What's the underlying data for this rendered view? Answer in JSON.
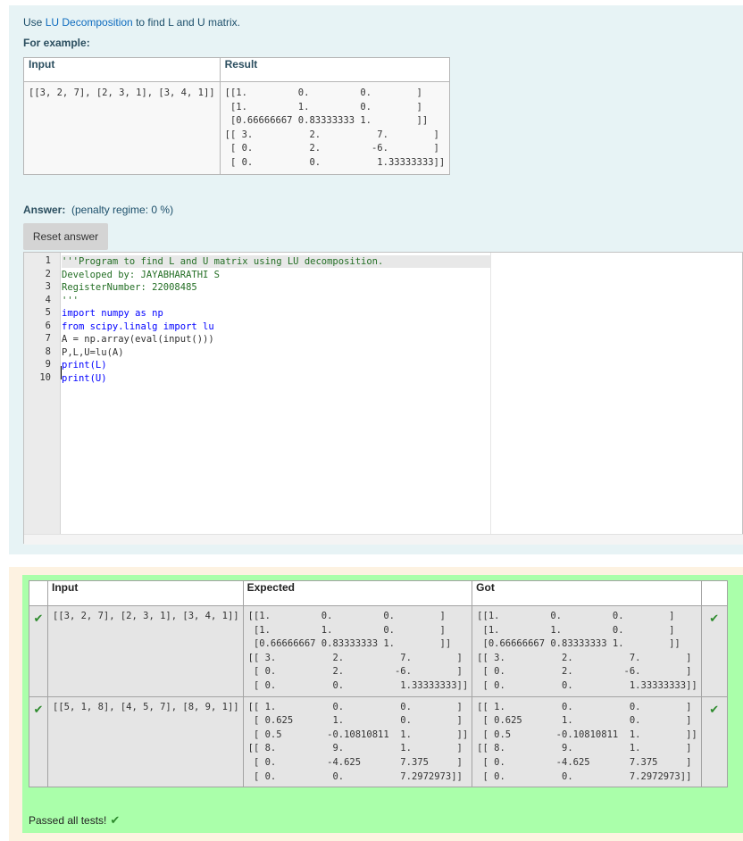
{
  "question": {
    "intro_prefix": "Use ",
    "intro_link": "LU Decomposition",
    "intro_suffix": " to find L and U matrix.",
    "for_example": "For example:",
    "example": {
      "headers": [
        "Input",
        "Result"
      ],
      "input": "[[3, 2, 7], [2, 3, 1], [3, 4, 1]]",
      "result": "[[1.         0.         0.        ]\n [1.         1.         0.        ]\n [0.66666667 0.83333333 1.        ]]\n[[ 3.          2.          7.        ]\n [ 0.          2.         -6.        ]\n [ 0.          0.          1.33333333]]"
    },
    "answer_label": "Answer:",
    "penalty": "(penalty regime: 0 %)",
    "reset_button": "Reset answer"
  },
  "editor": {
    "line_numbers": [
      "1",
      "2",
      "3",
      "4",
      "5",
      "6",
      "7",
      "8",
      "9",
      "10"
    ],
    "lines": [
      "'''Program to find L and U matrix using LU decomposition.",
      "Developed by: JAYABHARATHI S",
      "RegisterNumber: 22008485",
      "'''",
      "import numpy as np",
      "from scipy.linalg import lu",
      "A = np.array(eval(input()))",
      "P,L,U=lu(A)",
      "print(L)",
      "print(U)"
    ]
  },
  "results": {
    "headers": [
      "Input",
      "Expected",
      "Got"
    ],
    "rows": [
      {
        "input": "[[3, 2, 7], [2, 3, 1], [3, 4, 1]]",
        "expected": "[[1.         0.         0.        ]\n [1.         1.         0.        ]\n [0.66666667 0.83333333 1.        ]]\n[[ 3.          2.          7.        ]\n [ 0.          2.         -6.        ]\n [ 0.          0.          1.33333333]]",
        "got": "[[1.         0.         0.        ]\n [1.         1.         0.        ]\n [0.66666667 0.83333333 1.        ]]\n[[ 3.          2.          7.        ]\n [ 0.          2.         -6.        ]\n [ 0.          0.          1.33333333]]"
      },
      {
        "input": "[[5, 1, 8], [4, 5, 7], [8, 9, 1]]",
        "expected": "[[ 1.          0.          0.        ]\n [ 0.625       1.          0.        ]\n [ 0.5        -0.10810811  1.        ]]\n[[ 8.          9.          1.        ]\n [ 0.         -4.625       7.375     ]\n [ 0.          0.          7.2972973]]",
        "got": "[[ 1.          0.          0.        ]\n [ 0.625       1.          0.        ]\n [ 0.5        -0.10810811  1.        ]]\n[[ 8.          9.          1.        ]\n [ 0.         -4.625       7.375     ]\n [ 0.          0.          7.2972973]]"
      }
    ],
    "passed": "Passed all tests!"
  },
  "colors": {
    "question_bg": "#e7f3f5",
    "result_bg": "#aaffaa",
    "outer_bg": "#fdf2e1",
    "tick": "#2e8b2e",
    "link": "#0f6cbf"
  },
  "icons": {
    "pass": "check-icon"
  }
}
